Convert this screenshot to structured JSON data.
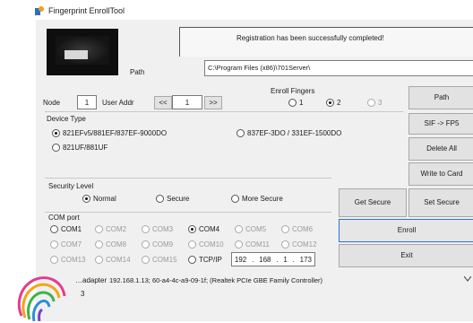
{
  "window": {
    "title": "Fingerprint EnrollTool"
  },
  "status": {
    "message": "Registration has been successfully completed!"
  },
  "path": {
    "label": "Path",
    "value": "C:\\Program Files (x86)\\701Server\\"
  },
  "node": {
    "label": "Node",
    "value": "1"
  },
  "user_addr": {
    "label": "User Addr",
    "prev": "<<",
    "value": "1",
    "next": ">>"
  },
  "enroll_fingers": {
    "label": "Enroll Fingers",
    "options": [
      "1",
      "2",
      "3"
    ],
    "selected": "2"
  },
  "device_type": {
    "label": "Device Type",
    "options": [
      "821EFv5/881EF/837EF-9000DO",
      "837EF-3DO / 331EF-1500DO",
      "821UF/881UF"
    ],
    "selected": "821EFv5/881EF/837EF-9000DO"
  },
  "security_level": {
    "label": "Security Level",
    "options": [
      "Normal",
      "Secure",
      "More Secure"
    ],
    "selected": "Normal"
  },
  "com_port": {
    "label": "COM port",
    "rows": [
      [
        "COM1",
        "COM2",
        "COM3",
        "COM4",
        "COM5",
        "COM6"
      ],
      [
        "COM7",
        "COM8",
        "COM9",
        "COM10",
        "COM11",
        "COM12"
      ],
      [
        "COM13",
        "COM14",
        "COM15",
        "TCP/IP"
      ]
    ],
    "selected": "COM4",
    "enabled": [
      "COM1",
      "COM4",
      "TCP/IP"
    ],
    "ip": [
      "192",
      "168",
      "1",
      "173"
    ]
  },
  "buttons": {
    "path": "Path",
    "sif_fp5": "SIF -> FP5",
    "delete_all": "Delete All",
    "write_to_card": "Write to Card",
    "get_secure": "Get Secure",
    "set_secure": "Set Secure",
    "enroll": "Enroll",
    "exit": "Exit"
  },
  "network_adapter": {
    "label_partial": "…adapter",
    "value": "192.168.1.13; 60-a4-4c-a9-09-1f; (Realtek PCIe GBE Family Controller)"
  },
  "footer_fragment": "3",
  "colors": {
    "accent_border": "#2f6fd6",
    "window_bg": "#f0f0f0",
    "dark_image": "#0e0e0e"
  }
}
